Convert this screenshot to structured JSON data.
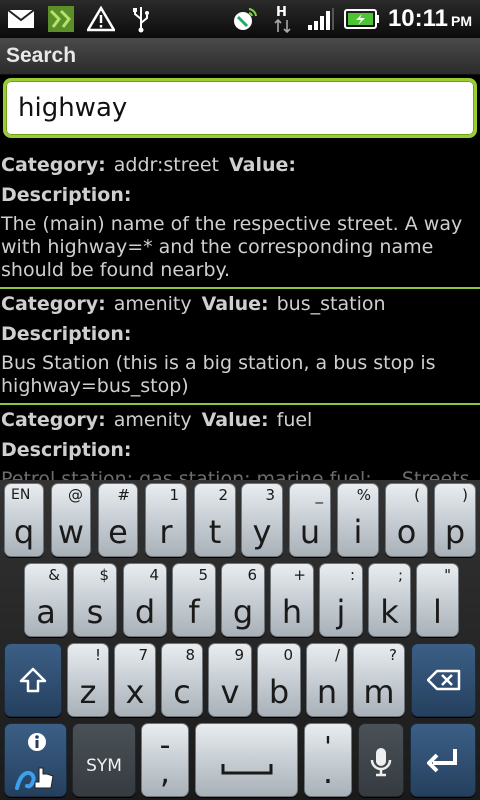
{
  "status": {
    "time": "10:11",
    "ampm": "PM",
    "icons": [
      "mail-icon",
      "app-icon",
      "warning-icon",
      "usb-icon",
      "gps-icon",
      "hsdpa-icon",
      "signal-icon",
      "battery-icon"
    ]
  },
  "title": "Search",
  "search": {
    "value": "highway"
  },
  "results": [
    {
      "category_label": "Category:",
      "category": "addr:street",
      "value_label": "Value:",
      "value": "",
      "description_label": "Description:",
      "description": "The (main) name of the respective street. A way with highway=* and the corresponding name should be found nearby."
    },
    {
      "category_label": "Category:",
      "category": "amenity",
      "value_label": "Value:",
      "value": "bus_station",
      "description_label": "Description:",
      "description": "Bus Station (this is a big station, a bus stop is highway=bus_stop)"
    },
    {
      "category_label": "Category:",
      "category": "amenity",
      "value_label": "Value:",
      "value": "fuel",
      "description_label": "Description:",
      "description": "Petrol station; gas station; marine fuel; ... Streets to"
    }
  ],
  "keyboard": {
    "row1": [
      {
        "main": "q",
        "alt": "EN"
      },
      {
        "main": "w",
        "alt": "@"
      },
      {
        "main": "e",
        "alt": "#"
      },
      {
        "main": "r",
        "alt": "1"
      },
      {
        "main": "t",
        "alt": "2"
      },
      {
        "main": "y",
        "alt": "3"
      },
      {
        "main": "u",
        "alt": "_"
      },
      {
        "main": "i",
        "alt": "%"
      },
      {
        "main": "o",
        "alt": "("
      },
      {
        "main": "p",
        "alt": ")"
      }
    ],
    "row2": [
      {
        "main": "a",
        "alt": "&"
      },
      {
        "main": "s",
        "alt": "$"
      },
      {
        "main": "d",
        "alt": "4"
      },
      {
        "main": "f",
        "alt": "5"
      },
      {
        "main": "g",
        "alt": "6"
      },
      {
        "main": "h",
        "alt": "+"
      },
      {
        "main": "j",
        "alt": ":"
      },
      {
        "main": "k",
        "alt": ";"
      },
      {
        "main": "l",
        "alt": "\""
      }
    ],
    "row3": [
      {
        "main": "z",
        "alt": "!"
      },
      {
        "main": "x",
        "alt": "7"
      },
      {
        "main": "c",
        "alt": "8"
      },
      {
        "main": "v",
        "alt": "9"
      },
      {
        "main": "b",
        "alt": "0"
      },
      {
        "main": "n",
        "alt": "/"
      },
      {
        "main": "m",
        "alt": "?"
      }
    ],
    "sym_label": "SYM",
    "comma": ",",
    "comma_alt": "-",
    "period": ".",
    "period_alt": "'",
    "shift_icon": "shift-icon",
    "backspace_icon": "backspace-icon",
    "enter_icon": "enter-icon",
    "mic_icon": "mic-icon",
    "info_icon": "info-icon"
  }
}
